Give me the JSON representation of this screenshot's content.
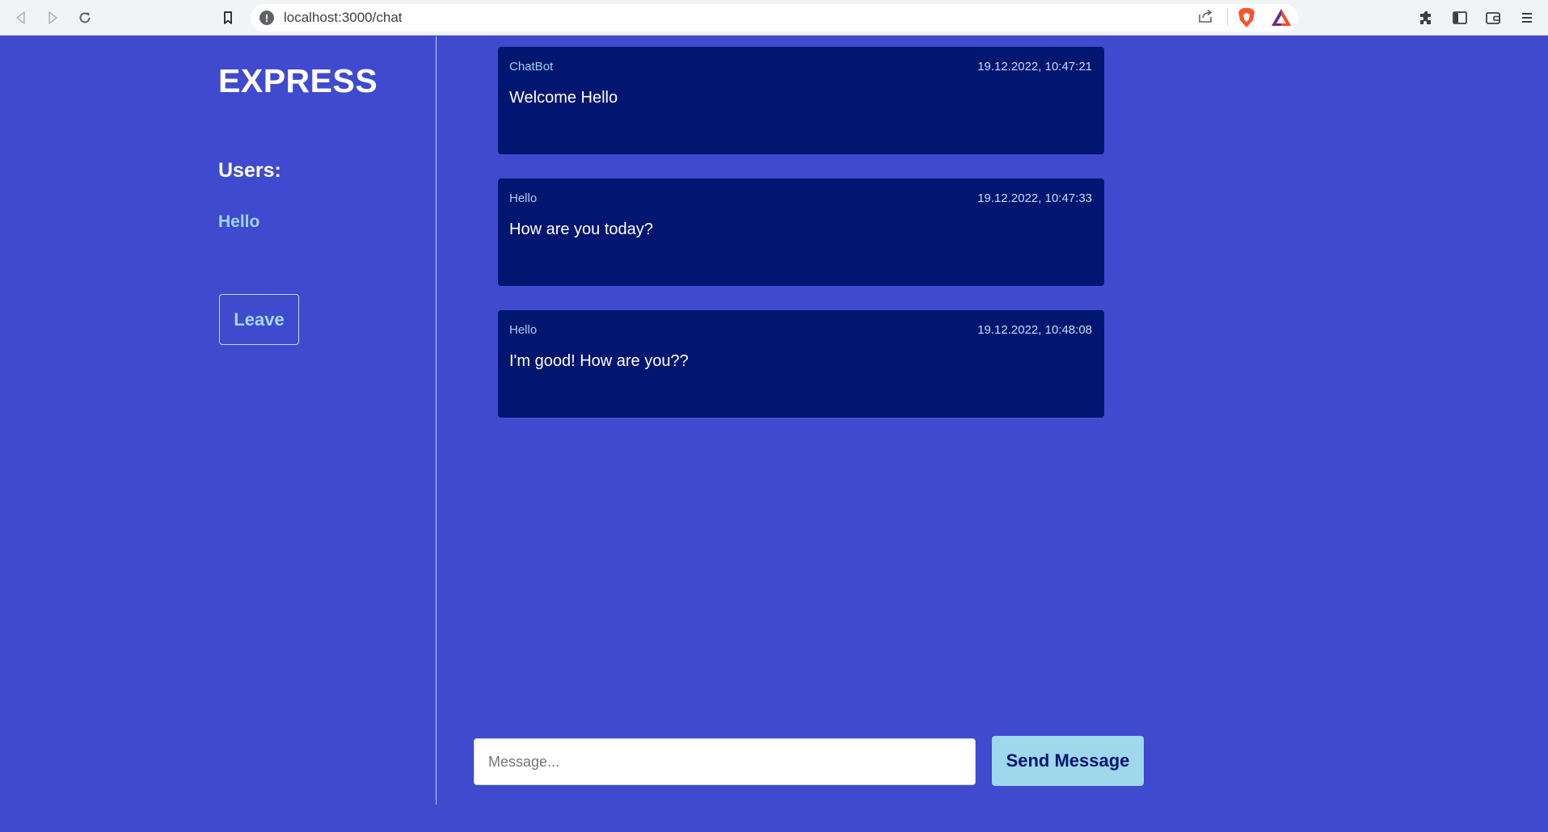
{
  "browser": {
    "url": "localhost:3000/chat"
  },
  "sidebar": {
    "logo": "EXPRESS",
    "users_heading": "Users:",
    "users": [
      "Hello"
    ],
    "leave_label": "Leave"
  },
  "messages": [
    {
      "author": "ChatBot",
      "time": "19.12.2022, 10:47:21",
      "text": "Welcome Hello"
    },
    {
      "author": "Hello",
      "time": "19.12.2022, 10:47:33",
      "text": "How are you today?"
    },
    {
      "author": "Hello",
      "time": "19.12.2022, 10:48:08",
      "text": "I'm good! How are you??"
    }
  ],
  "composer": {
    "placeholder": "Message...",
    "value": "",
    "send_label": "Send Message"
  },
  "colors": {
    "page_background": "#3f4acf",
    "message_background": "#001670",
    "accent": "#9fd7ec"
  },
  "icons": {
    "toolbar": [
      "back-icon",
      "forward-icon",
      "reload-icon",
      "bookmark-icon",
      "site-info-icon",
      "share-icon",
      "brave-shields-icon",
      "brave-rewards-icon",
      "extensions-icon",
      "sidebar-toggle-icon",
      "wallet-icon",
      "menu-icon"
    ]
  }
}
